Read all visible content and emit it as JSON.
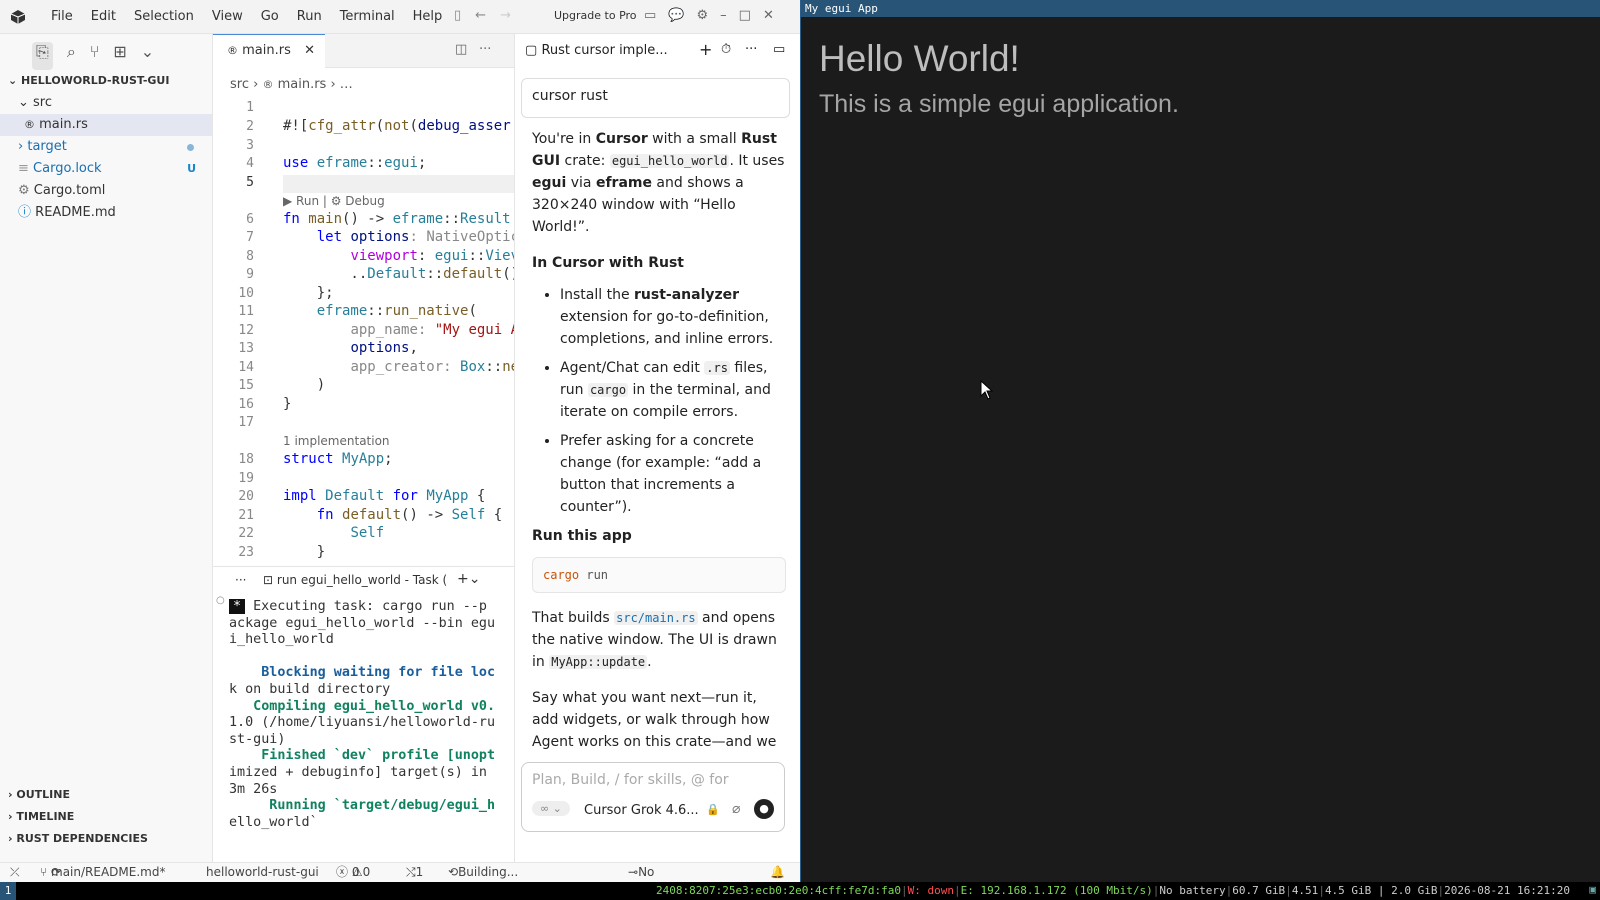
{
  "titlebar": {
    "menu": [
      "File",
      "Edit",
      "Selection",
      "View",
      "Go",
      "Run",
      "Terminal",
      "Help"
    ],
    "upgrade": "Upgrade to Pro"
  },
  "sidebar": {
    "project": "HELLOWORLD-RUST-GUI",
    "tree": [
      {
        "label": "src",
        "indent": 1,
        "kind": "folder-open"
      },
      {
        "label": "main.rs",
        "indent": 2,
        "kind": "rust",
        "selected": true
      },
      {
        "label": "target",
        "indent": 1,
        "kind": "folder",
        "badge": "dot"
      },
      {
        "label": "Cargo.lock",
        "indent": 1,
        "kind": "lock",
        "badge": "U"
      },
      {
        "label": "Cargo.toml",
        "indent": 1,
        "kind": "gear"
      },
      {
        "label": "README.md",
        "indent": 1,
        "kind": "info"
      }
    ],
    "sections": [
      "OUTLINE",
      "TIMELINE",
      "RUST DEPENDENCIES"
    ]
  },
  "editor": {
    "tab": "main.rs",
    "breadcrumb": [
      "src",
      "main.rs",
      "…"
    ],
    "run_lens": "▶ Run | ⚙ Debug",
    "impl_lens": "1 implementation"
  },
  "terminal": {
    "tab": "run egui_hello_world - Task (",
    "star": "*",
    "line1": " Executing task: cargo run --p",
    "lines": [
      "ackage egui_hello_world --bin egu",
      "i_hello_world",
      "",
      "    Blocking waiting for file loc",
      "k on build directory",
      "   Compiling egui_hello_world v0.",
      "1.0 (/home/liyuansi/helloworld-ru",
      "st-gui)",
      "    Finished `dev` profile [unopt",
      "imized + debuginfo] target(s) in",
      "3m 26s",
      "     Running `target/debug/egui_h",
      "ello_world`"
    ]
  },
  "chat": {
    "title": "Rust cursor imple...",
    "query": "cursor rust",
    "p1a": "You're in ",
    "p1b": "Cursor",
    "p1c": " with a small ",
    "p1d": "Rust GUI",
    "p1e": " crate: ",
    "p1f": "egui_hello_world",
    "p1g": ". It uses ",
    "p1h": "egui",
    "p1i": " via ",
    "p1j": "eframe",
    "p1k": " and shows a 320×240 window with “Hello World!”.",
    "h1": "In Cursor with Rust",
    "b1a": "Install the ",
    "b1b": "rust-analyzer",
    "b1c": " extension for go-to-definition, completions, and inline errors.",
    "b2a": "Agent/Chat can edit ",
    "b2b": ".rs",
    "b2c": " files, run ",
    "b2d": "cargo",
    "b2e": " in the terminal, and iterate on compile errors.",
    "b3": "Prefer asking for a concrete change (for example: “add a button that increments a counter”).",
    "h2": "Run this app",
    "cmd1": "cargo",
    "cmd2": " run",
    "p2a": "That builds ",
    "p2b": "src/main.rs",
    "p2c": " and opens the native window. The UI is drawn in ",
    "p2d": "MyApp::update",
    "p2e": ".",
    "p3": "Say what you want next—run it, add widgets, or walk through how Agent works on this crate—and we",
    "input_placeholder": "Plan, Build, / for skills, @ for",
    "model": "Cursor Grok 4.6..."
  },
  "vstatus": {
    "branch": "main/README.md*",
    "project": "helloworld-rust-gui",
    "errors": "0",
    "warnings": "0",
    "ports": "1",
    "building": "Building...",
    "commit": "No commit scored"
  },
  "egui": {
    "window_title": "My egui App",
    "heading": "Hello World!",
    "subtitle": "This is a simple egui application."
  },
  "system": {
    "workspace": "1",
    "ipv6": "2408:8207:25e3:ecb0:2e0:4cff:fe7d:fa0",
    "wlan": "W: down",
    "eth": "E: 192.168.1.172 (100 Mbit/s)",
    "battery": "No battery",
    "disk": "60.7 GiB",
    "load": "4.51",
    "mem": "4.5 GiB | 2.0 GiB",
    "datetime": "2026-08-21 16:21:20"
  }
}
